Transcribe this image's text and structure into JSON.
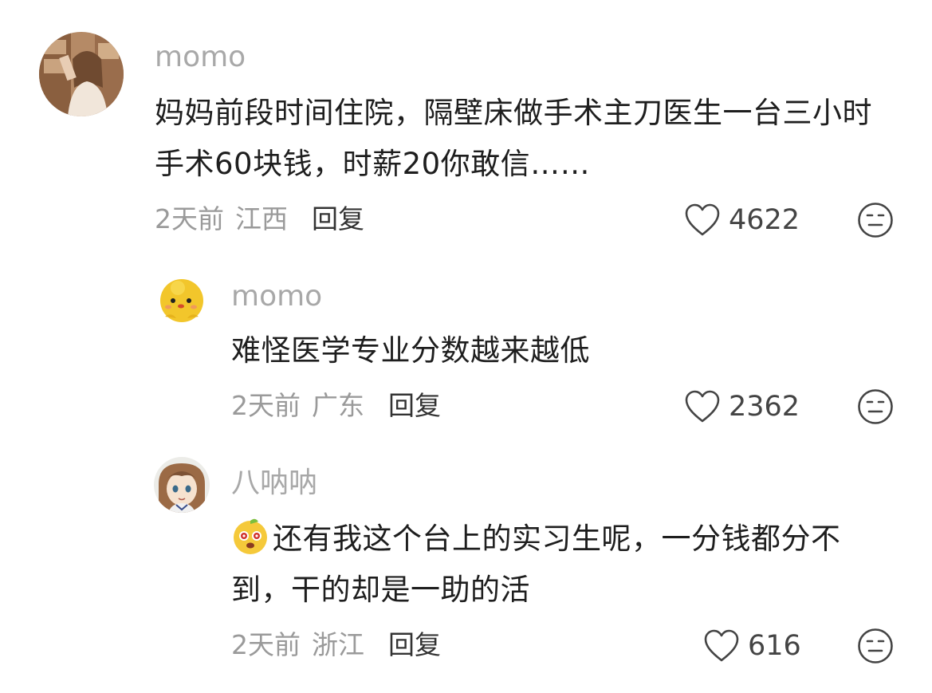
{
  "comments": [
    {
      "author": "momo",
      "text": "妈妈前段时间住院，隔壁床做手术主刀医生一台三小时手术60块钱，时薪20你敢信……",
      "time": "2天前",
      "location": "江西",
      "reply_label": "回复",
      "likes": "4622",
      "avatar_icon": "photo-avatar-icon"
    },
    {
      "author": "momo",
      "text": "难怪医学专业分数越来越低",
      "time": "2天前",
      "location": "广东",
      "reply_label": "回复",
      "likes": "2362",
      "avatar_icon": "yellow-chick-avatar-icon"
    },
    {
      "author": "八呐呐",
      "text": "还有我这个台上的实习生呢，一分钱都分不到，干的却是一助的活",
      "time": "2天前",
      "location": "浙江",
      "reply_label": "回复",
      "likes": "616",
      "avatar_icon": "anime-girl-avatar-icon",
      "inline_emoji": "cute-face-emoji-icon"
    }
  ],
  "colors": {
    "author": "#a8a8a8",
    "text": "#1e1e1e",
    "meta": "#9a9a9a",
    "reply": "#333333",
    "icon": "#444444"
  }
}
